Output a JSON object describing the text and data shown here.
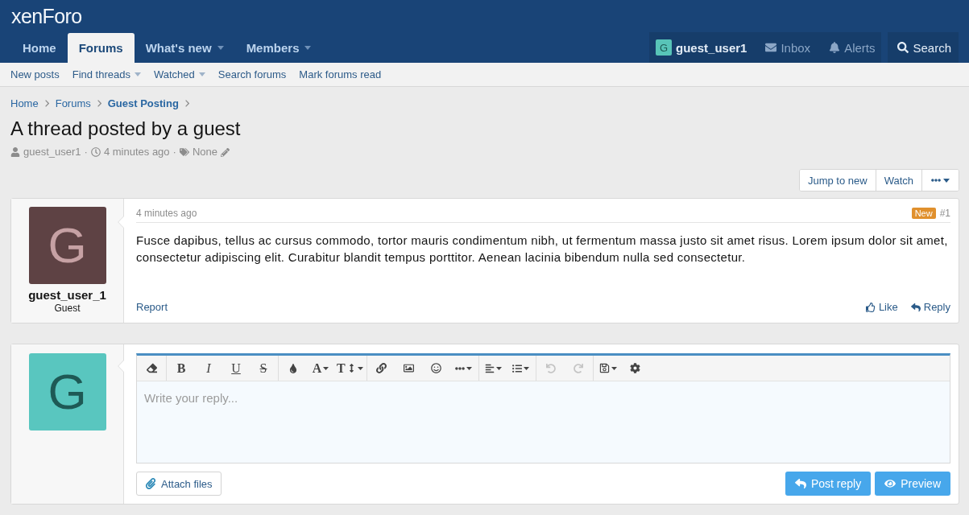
{
  "header": {
    "logo": "xenForo"
  },
  "nav": {
    "tabs": [
      {
        "label": "Home",
        "selected": false,
        "dropdown": false
      },
      {
        "label": "Forums",
        "selected": true,
        "dropdown": false
      },
      {
        "label": "What's new",
        "selected": false,
        "dropdown": true
      },
      {
        "label": "Members",
        "selected": false,
        "dropdown": true
      }
    ],
    "account": [
      {
        "kind": "user",
        "avatar_letter": "G",
        "label": "guest_user1",
        "dimmed": false
      },
      {
        "kind": "inbox",
        "label": "Inbox",
        "dimmed": true
      },
      {
        "kind": "alerts",
        "label": "Alerts",
        "dimmed": true
      }
    ],
    "search": {
      "label": "Search"
    }
  },
  "subnav": [
    {
      "label": "New posts",
      "dropdown": false
    },
    {
      "label": "Find threads",
      "dropdown": true
    },
    {
      "label": "Watched",
      "dropdown": true
    },
    {
      "label": "Search forums",
      "dropdown": false
    },
    {
      "label": "Mark forums read",
      "dropdown": false
    }
  ],
  "breadcrumb": [
    {
      "label": "Home",
      "current": false
    },
    {
      "label": "Forums",
      "current": false
    },
    {
      "label": "Guest Posting",
      "current": true
    }
  ],
  "thread": {
    "title": "A thread posted by a guest",
    "meta": [
      {
        "kind": "author",
        "text": "guest_user1"
      },
      {
        "kind": "separator",
        "text": "·"
      },
      {
        "kind": "date",
        "text": "4 minutes ago"
      },
      {
        "kind": "separator",
        "text": "·"
      },
      {
        "kind": "tags",
        "text": "None"
      }
    ],
    "actions": [
      {
        "kind": "link",
        "label": "Jump to new"
      },
      {
        "kind": "link",
        "label": "Watch"
      },
      {
        "kind": "menu"
      }
    ]
  },
  "post": {
    "author": {
      "avatar_letter": "G",
      "name": "guest_user_1",
      "title": "Guest"
    },
    "date": "4 minutes ago",
    "badge": "New",
    "number": "#1",
    "body": "Fusce dapibus, tellus ac cursus commodo, tortor mauris condimentum nibh, ut fermentum massa justo sit amet risus. Lorem ipsum dolor sit amet, consectetur adipiscing elit. Curabitur blandit tempus porttitor. Aenean lacinia bibendum nulla sed consectetur.",
    "footer": {
      "left": [
        {
          "kind": "report",
          "label": "Report"
        }
      ],
      "right": [
        {
          "kind": "like",
          "label": "Like"
        },
        {
          "kind": "reply",
          "label": "Reply"
        }
      ]
    }
  },
  "reply": {
    "avatar_letter": "G",
    "toolbar": [
      [
        {
          "kind": "clear",
          "dropdown": false,
          "disabled": false
        }
      ],
      [
        {
          "kind": "bold",
          "label": "B",
          "dropdown": false,
          "disabled": false
        },
        {
          "kind": "italic",
          "label": "I",
          "dropdown": false,
          "disabled": false
        },
        {
          "kind": "underline",
          "label": "U",
          "dropdown": false,
          "disabled": false
        },
        {
          "kind": "strike",
          "label": "S",
          "dropdown": false,
          "disabled": false
        }
      ],
      [
        {
          "kind": "color",
          "dropdown": false,
          "disabled": false
        },
        {
          "kind": "font",
          "label": "A",
          "dropdown": true,
          "disabled": false
        },
        {
          "kind": "size",
          "label": "T",
          "dropdown": true,
          "disabled": false
        }
      ],
      [
        {
          "kind": "link",
          "dropdown": false,
          "disabled": false
        },
        {
          "kind": "image",
          "dropdown": false,
          "disabled": false
        },
        {
          "kind": "smilies",
          "dropdown": false,
          "disabled": false
        },
        {
          "kind": "insert",
          "dropdown": true,
          "disabled": false
        }
      ],
      [
        {
          "kind": "align",
          "dropdown": true,
          "disabled": false
        },
        {
          "kind": "list",
          "dropdown": true,
          "disabled": false
        }
      ],
      [
        {
          "kind": "undo",
          "dropdown": false,
          "disabled": true
        },
        {
          "kind": "redo",
          "dropdown": false,
          "disabled": true
        }
      ],
      [
        {
          "kind": "drafts",
          "dropdown": true,
          "disabled": false
        },
        {
          "kind": "options",
          "dropdown": false,
          "disabled": false
        }
      ]
    ],
    "placeholder": "Write your reply...",
    "attach": {
      "label": "Attach files"
    },
    "buttons": [
      {
        "kind": "submit",
        "label": "Post reply"
      },
      {
        "kind": "preview",
        "label": "Preview"
      }
    ]
  }
}
